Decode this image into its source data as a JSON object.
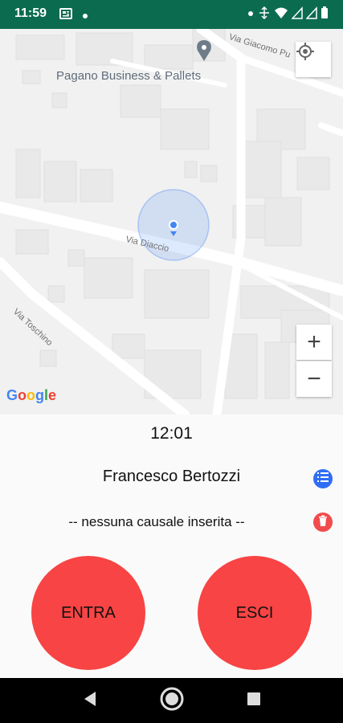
{
  "status_bar": {
    "time": "11:59",
    "left_icons": [
      "news-icon",
      "notification-dot-icon"
    ],
    "right_icons": [
      "notification-dot-icon",
      "data-saver-icon",
      "wifi-icon",
      "signal-icon",
      "signal-icon",
      "battery-icon"
    ]
  },
  "map": {
    "poi_label": "Pagano Business & Pallets",
    "streets": {
      "giacomo": "Via Giacomo Pu",
      "diaccio": "Via Diaccio",
      "toschino": "Via Toschino"
    },
    "zoom_in": "+",
    "zoom_out": "−",
    "logo": {
      "letters": [
        "G",
        "o",
        "o",
        "g",
        "l",
        "e"
      ],
      "colors": [
        "#4285F4",
        "#EA4335",
        "#FBBC05",
        "#4285F4",
        "#34A853",
        "#EA4335"
      ]
    }
  },
  "panel": {
    "time": "12:01",
    "user_name": "Francesco Bertozzi",
    "causale": "-- nessuna causale inserita --",
    "enter_label": "ENTRA",
    "exit_label": "ESCI"
  },
  "colors": {
    "status_bar": "#0b6b4e",
    "action_button": "#f84444",
    "list_icon": "#2f6df5",
    "delete_icon": "#f24b4b",
    "location_dot": "#4285F4"
  }
}
